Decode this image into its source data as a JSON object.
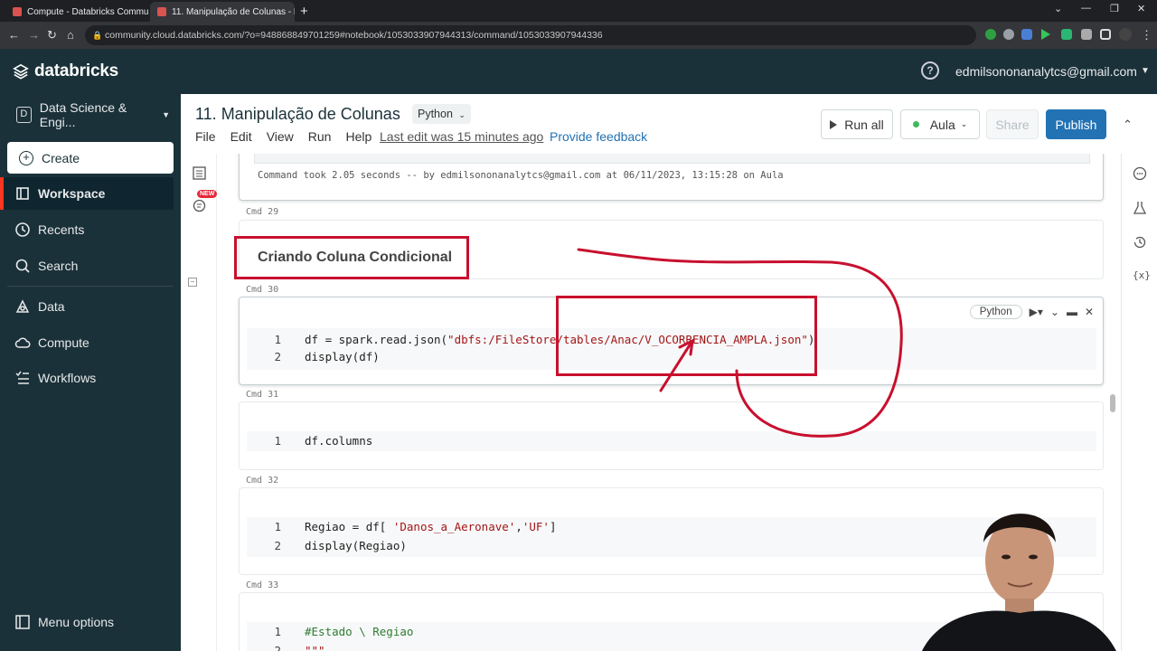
{
  "browser": {
    "tabs": [
      {
        "title": "Compute - Databricks Communi",
        "active": false
      },
      {
        "title": "11. Manipulação de Colunas - D",
        "active": true
      }
    ],
    "url": "community.cloud.databricks.com/?o=948868849701259#notebook/1053033907944313/command/1053033907944336"
  },
  "header": {
    "brand": "databricks",
    "user": "edmilsononanalytcs@gmail.com"
  },
  "sidebar": {
    "workspace_selector": "Data Science & Engi...",
    "create_label": "Create",
    "items": [
      {
        "label": "Workspace",
        "icon": "workspace-icon",
        "active": true
      },
      {
        "label": "Recents",
        "icon": "clock-icon",
        "active": false
      },
      {
        "label": "Search",
        "icon": "search-icon",
        "active": false
      },
      {
        "label": "Data",
        "icon": "data-icon",
        "active": false
      },
      {
        "label": "Compute",
        "icon": "cloud-icon",
        "active": false
      },
      {
        "label": "Workflows",
        "icon": "workflows-icon",
        "active": false
      }
    ],
    "menu_options": "Menu options"
  },
  "notebook": {
    "title": "11. Manipulação de Colunas",
    "language": "Python",
    "menu": [
      "File",
      "Edit",
      "View",
      "Run",
      "Help"
    ],
    "last_edit": "Last edit was 15 minutes ago",
    "feedback": "Provide feedback",
    "run_all": "Run all",
    "cluster": "Aula",
    "share": "Share",
    "publish": "Publish",
    "new_badge": "NEW"
  },
  "cells": {
    "prev_output": "Command took 2.05 seconds -- by edmilsononanalytcs@gmail.com at 06/11/2023, 13:15:28 on Aula",
    "cmd29": "Cmd 29",
    "cmd29_title": "Criando Coluna Condicional",
    "cmd30": "Cmd 30",
    "cmd30_lang": "Python",
    "cmd30_line1_pre": "df = spark.read.json(",
    "cmd30_line1_str": "\"dbfs:/FileStore/tables/Anac/V_OCORRENCIA_AMPLA.json\"",
    "cmd30_line1_post": ")",
    "cmd30_line2": "display(df)",
    "cmd31": "Cmd 31",
    "cmd31_line1": "df.columns",
    "cmd32": "Cmd 32",
    "cmd32_line1_pre": "Regiao = df[ ",
    "cmd32_line1_str1": "'Danos_a_Aeronave'",
    "cmd32_line1_mid": ",",
    "cmd32_line1_str2": "'UF'",
    "cmd32_line1_post": "]",
    "cmd32_line2": "display(Regiao)",
    "cmd33": "Cmd 33",
    "cmd33_line1": "#Estado \\ Regiao",
    "cmd33_line2": "\"\"\""
  },
  "colors": {
    "sidebar_bg": "#1b3139",
    "accent_red": "#c8102e",
    "publish_blue": "#2272b4"
  }
}
